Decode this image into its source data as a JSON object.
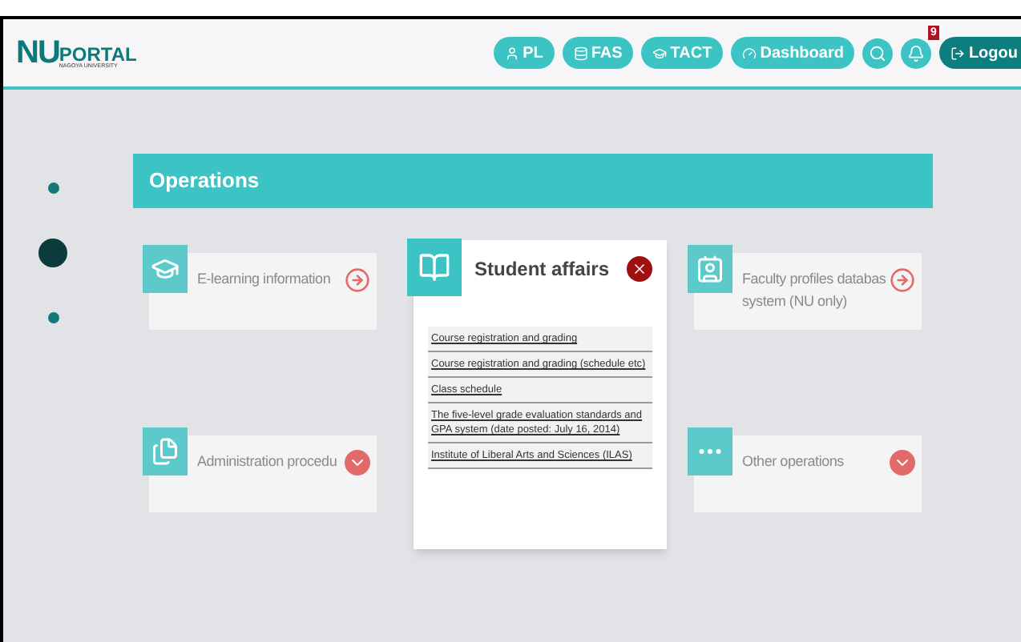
{
  "header": {
    "logo": {
      "main": "NU",
      "portal": "PORTAL",
      "sub": "NAGOYA UNIVERSITY"
    },
    "nav": [
      {
        "kind": "pl",
        "label": "PL"
      },
      {
        "kind": "fas",
        "label": "FAS"
      },
      {
        "kind": "tact",
        "label": "TACT"
      },
      {
        "kind": "dashboard",
        "label": "Dashboard"
      },
      {
        "kind": "search"
      },
      {
        "kind": "bell",
        "badge": "9"
      },
      {
        "kind": "logout",
        "label": "Logou"
      }
    ]
  },
  "side_dots": [
    {
      "selected": false
    },
    {
      "selected": true
    },
    {
      "selected": false
    }
  ],
  "section_title": "Operations",
  "cards": [
    {
      "kind": "elearning",
      "title": "E-learning information",
      "expandable": false,
      "expanded": false
    },
    {
      "kind": "student",
      "title": "Student affairs",
      "expanded": true,
      "links": [
        "Course registration and grading",
        "Course registration and grading (schedule etc)",
        "Class schedule",
        "The five-level grade evaluation standards and GPA system (date posted: July 16, 2014)",
        "Institute of Liberal Arts and Sciences (ILAS)"
      ]
    },
    {
      "kind": "faculty",
      "title": "Faculty profiles databas system (NU only)",
      "expandable": false,
      "expanded": false
    },
    {
      "kind": "admin",
      "title": "Administration procedu",
      "expandable": true,
      "expanded": false
    },
    {
      "kind": "other",
      "title": "Other operations",
      "expandable": true,
      "expanded": false
    }
  ]
}
